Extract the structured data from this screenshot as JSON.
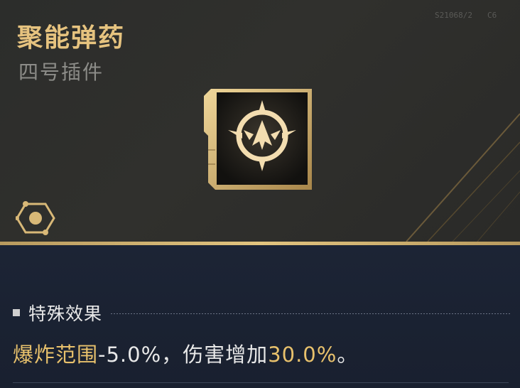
{
  "item": {
    "title": "聚能弹药",
    "subtitle": "四号插件",
    "serial_left": "S21068/2",
    "serial_right": "C6",
    "icon": "targeting-burst-icon",
    "badge_icon": "plugin-slot-icon"
  },
  "effect": {
    "section_label": "特殊效果",
    "part1": "爆炸范围",
    "part2": "-5.0%",
    "part3": "，伤害增加",
    "part4": "30.0%",
    "part5": "。"
  },
  "colors": {
    "accent_gold": "#e6c37f",
    "effect_gold": "#e8c16c",
    "top_bg": "#2c2d2b",
    "bottom_bg": "#1c2435"
  }
}
